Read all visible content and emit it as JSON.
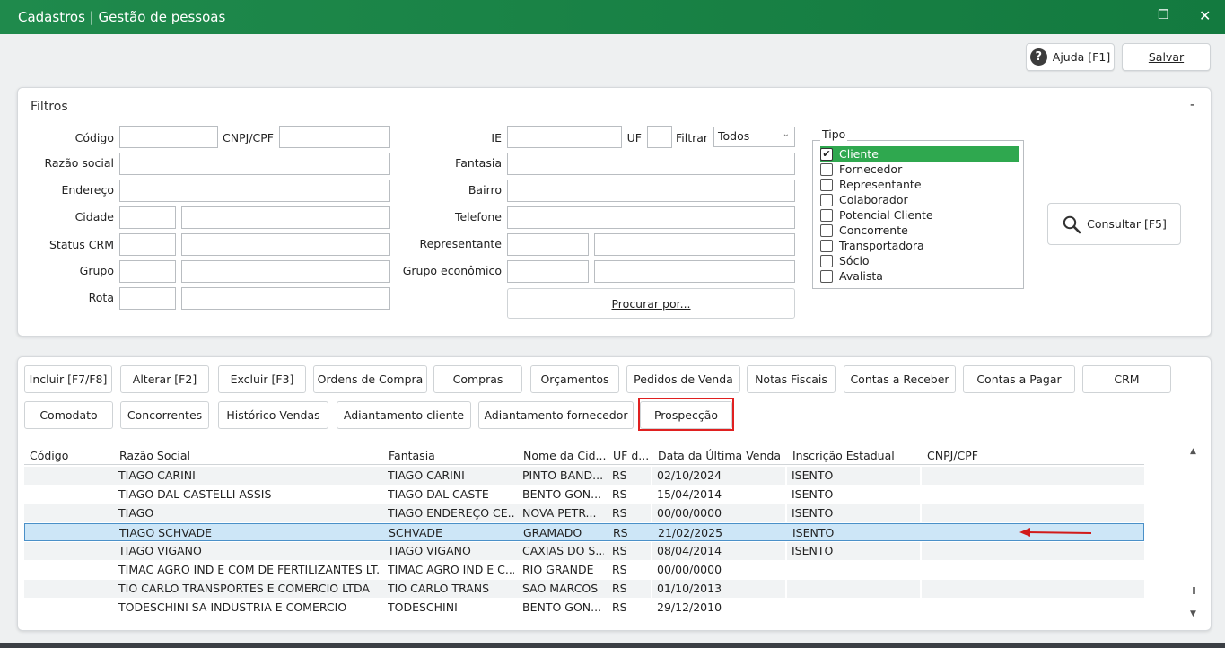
{
  "window": {
    "title": "Cadastros | Gestão de pessoas"
  },
  "top_actions": {
    "help_label": "Ajuda [F1]",
    "save_label": "Salvar"
  },
  "filters": {
    "title": "Filtros",
    "collapse_label": "-",
    "codigo_label": "Código",
    "cnpj_label": "CNPJ/CPF",
    "razao_label": "Razão social",
    "endereco_label": "Endereço",
    "cidade_label": "Cidade",
    "status_crm_label": "Status CRM",
    "grupo_label": "Grupo",
    "rota_label": "Rota",
    "ie_label": "IE",
    "uf_label": "UF",
    "filtrar_label": "Filtrar",
    "filtrar_value": "Todos",
    "fantasia_label": "Fantasia",
    "bairro_label": "Bairro",
    "telefone_label": "Telefone",
    "representante_label": "Representante",
    "grupo_economico_label": "Grupo econômico",
    "procurar_label": "Procurar por...",
    "consultar_label": "Consultar [F5]"
  },
  "tipo": {
    "legend": "Tipo",
    "items": [
      {
        "label": "Cliente",
        "checked": true
      },
      {
        "label": "Fornecedor",
        "checked": false
      },
      {
        "label": "Representante",
        "checked": false
      },
      {
        "label": "Colaborador",
        "checked": false
      },
      {
        "label": "Potencial Cliente",
        "checked": false
      },
      {
        "label": "Concorrente",
        "checked": false
      },
      {
        "label": "Transportadora",
        "checked": false
      },
      {
        "label": "Sócio",
        "checked": false
      },
      {
        "label": "Avalista",
        "checked": false
      }
    ]
  },
  "actions": {
    "row1": [
      "Incluir [F7/F8]",
      "Alterar [F2]",
      "Excluir [F3]",
      "Ordens de Compra",
      "Compras",
      "Orçamentos",
      "Pedidos de Venda",
      "Notas Fiscais",
      "Contas a Receber",
      "Contas a Pagar",
      "CRM"
    ],
    "row2": [
      "Comodato",
      "Concorrentes",
      "Histórico Vendas",
      "Adiantamento cliente",
      "Adiantamento fornecedor",
      "Prospecção"
    ]
  },
  "grid": {
    "columns": [
      "Código",
      "Razão Social",
      "Fantasia",
      "Nome da Cid...",
      "UF d...",
      "Data da Última Venda",
      "Inscrição Estadual",
      "CNPJ/CPF"
    ],
    "rows": [
      [
        "",
        "TIAGO CARINI",
        "TIAGO CARINI",
        "PINTO BAND...",
        "RS",
        "02/10/2024",
        "ISENTO",
        ""
      ],
      [
        "",
        "TIAGO DAL CASTELLI ASSIS",
        "TIAGO DAL CASTE",
        "BENTO GON...",
        "RS",
        "15/04/2014",
        "ISENTO",
        ""
      ],
      [
        "",
        "TIAGO",
        "TIAGO ENDEREÇO CE...",
        "NOVA PETR...",
        "RS",
        "00/00/0000",
        "ISENTO",
        ""
      ],
      [
        "",
        "TIAGO SCHVADE",
        "SCHVADE",
        "GRAMADO",
        "RS",
        "21/02/2025",
        "ISENTO",
        ""
      ],
      [
        "",
        "TIAGO VIGANO",
        "TIAGO VIGANO",
        "CAXIAS DO S...",
        "RS",
        "08/04/2014",
        "ISENTO",
        ""
      ],
      [
        "",
        "TIMAC AGRO IND E COM DE FERTILIZANTES LT...",
        "TIMAC AGRO IND E C...",
        "RIO GRANDE",
        "RS",
        "00/00/0000",
        "",
        ""
      ],
      [
        "",
        "TIO CARLO TRANSPORTES E COMERCIO LTDA",
        "TIO CARLO TRANS",
        "SAO MARCOS",
        "RS",
        "01/10/2013",
        "",
        ""
      ],
      [
        "",
        "TODESCHINI SA INDUSTRIA E COMERCIO",
        "TODESCHINI",
        "BENTO GON...",
        "RS",
        "29/12/2010",
        "",
        ""
      ]
    ],
    "selected_row": 3
  },
  "colors": {
    "title_bar": "#1f8a4c",
    "checked_row": "#2fa84f",
    "highlight_box": "#e02020",
    "arrow": "#d11a1a",
    "selection": "#cde6f7"
  }
}
